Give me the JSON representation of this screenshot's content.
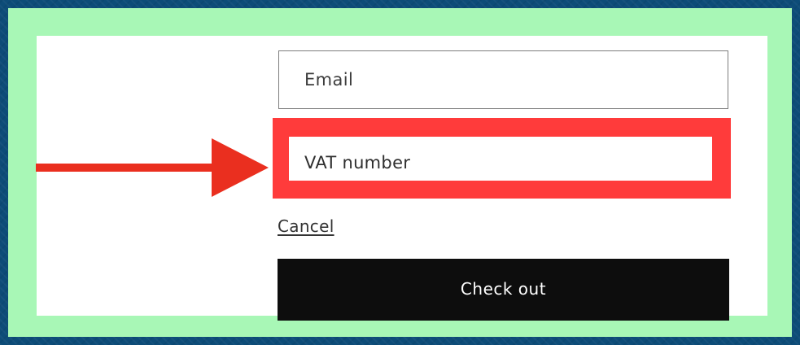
{
  "form": {
    "email_placeholder": "Email",
    "vat_placeholder": "VAT number",
    "cancel_label": "Cancel",
    "checkout_label": "Check out"
  },
  "annotation": {
    "highlight_color": "#ff3b3b",
    "arrow_color": "#ea2f1f"
  },
  "theme": {
    "outer_background": "#0d4c78",
    "frame_background": "#a8f7b6",
    "panel_background": "#ffffff",
    "button_background": "#0d0d0d",
    "button_text": "#ffffff"
  },
  "icons": {
    "arrow": "right-arrow"
  }
}
